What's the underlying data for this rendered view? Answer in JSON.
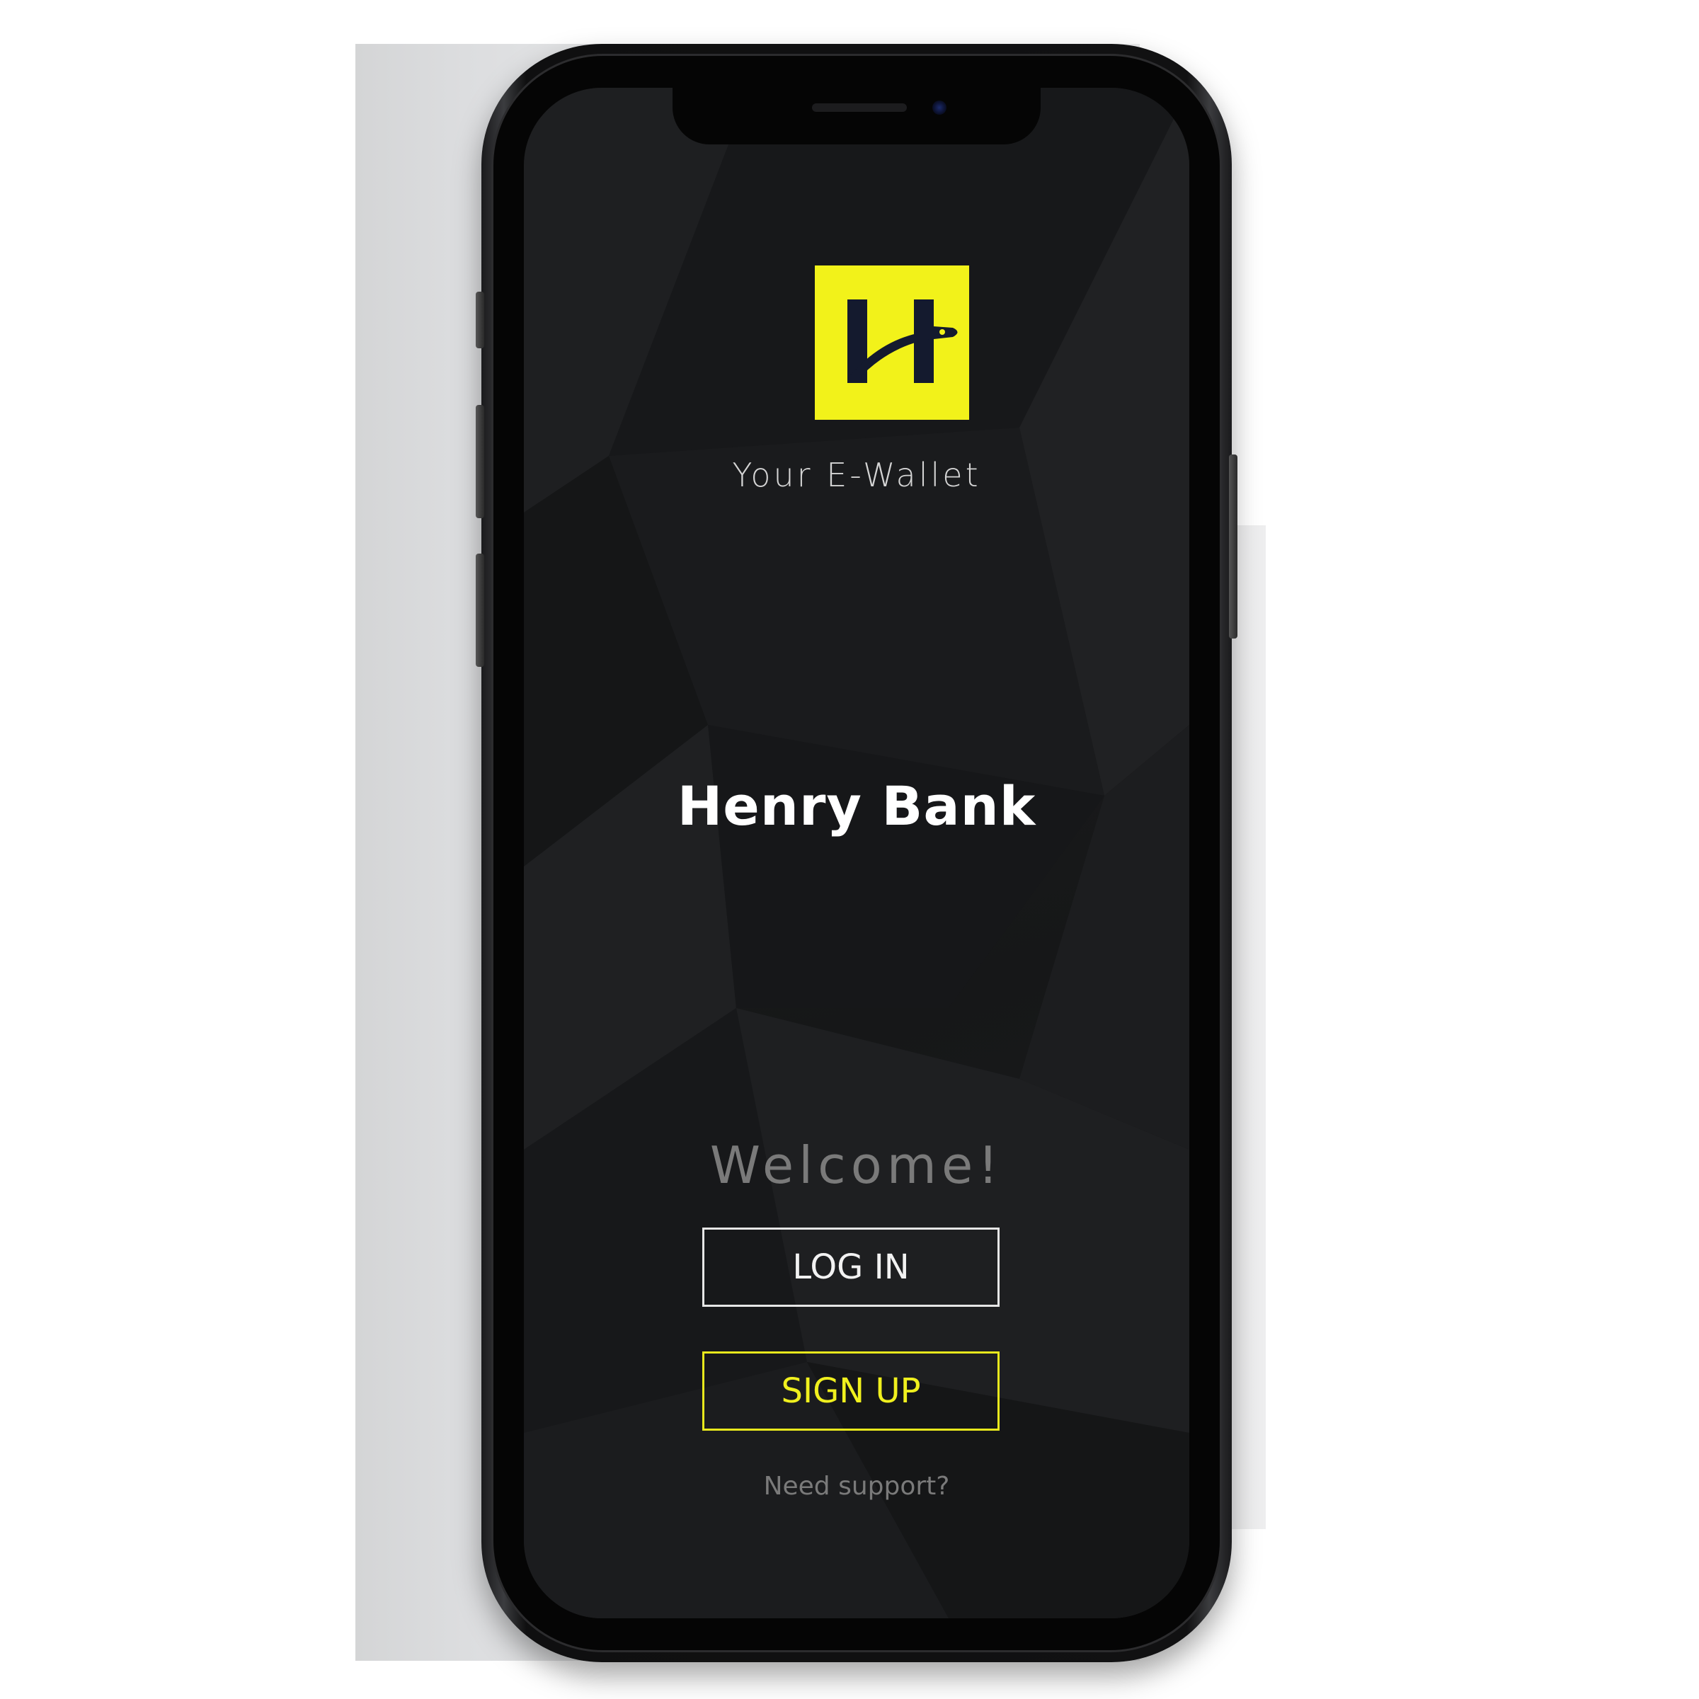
{
  "app": {
    "name": "Henry Bank",
    "logo_icon": "henry-bank-h-logo",
    "tagline": "Your E-Wallet"
  },
  "welcome": {
    "heading": "Welcome!"
  },
  "actions": {
    "login_label": "LOG IN",
    "signup_label": "SIGN UP",
    "support_label": "Need support?"
  },
  "colors": {
    "accent_yellow": "#f2f21a",
    "screen_background": "#1a1b1c",
    "logo_mark": "#141a2e"
  }
}
